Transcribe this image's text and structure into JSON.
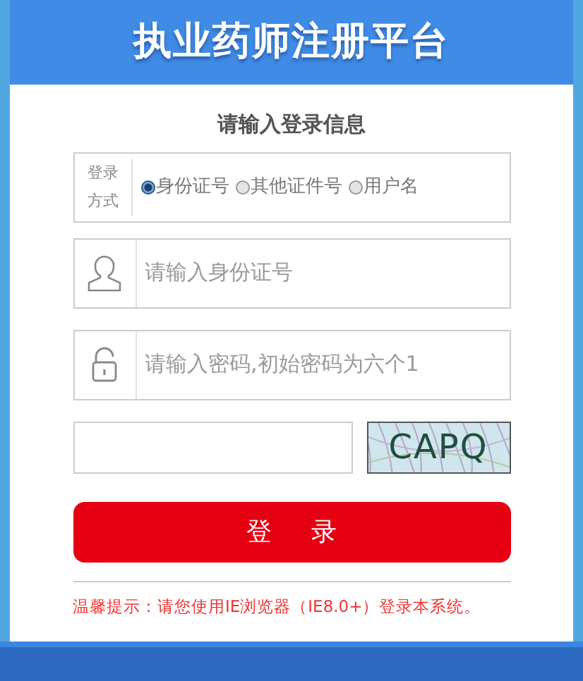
{
  "header": {
    "title": "执业药师注册平台"
  },
  "form": {
    "heading": "请输入登录信息",
    "login_method": {
      "label": "登录方式",
      "options": [
        {
          "label": "身份证号",
          "selected": true
        },
        {
          "label": "其他证件号",
          "selected": false
        },
        {
          "label": "用户名",
          "selected": false
        }
      ]
    },
    "fields": [
      {
        "kind": "user",
        "placeholder": "请输入身份证号"
      },
      {
        "kind": "lock",
        "placeholder": "请输入密码,初始密码为六个1"
      }
    ],
    "captcha": {
      "code": "CAPQ"
    },
    "login_button": "登 录",
    "notice": "温馨提示：请您使用IE浏览器（IE8.0+）登录本系统。"
  }
}
